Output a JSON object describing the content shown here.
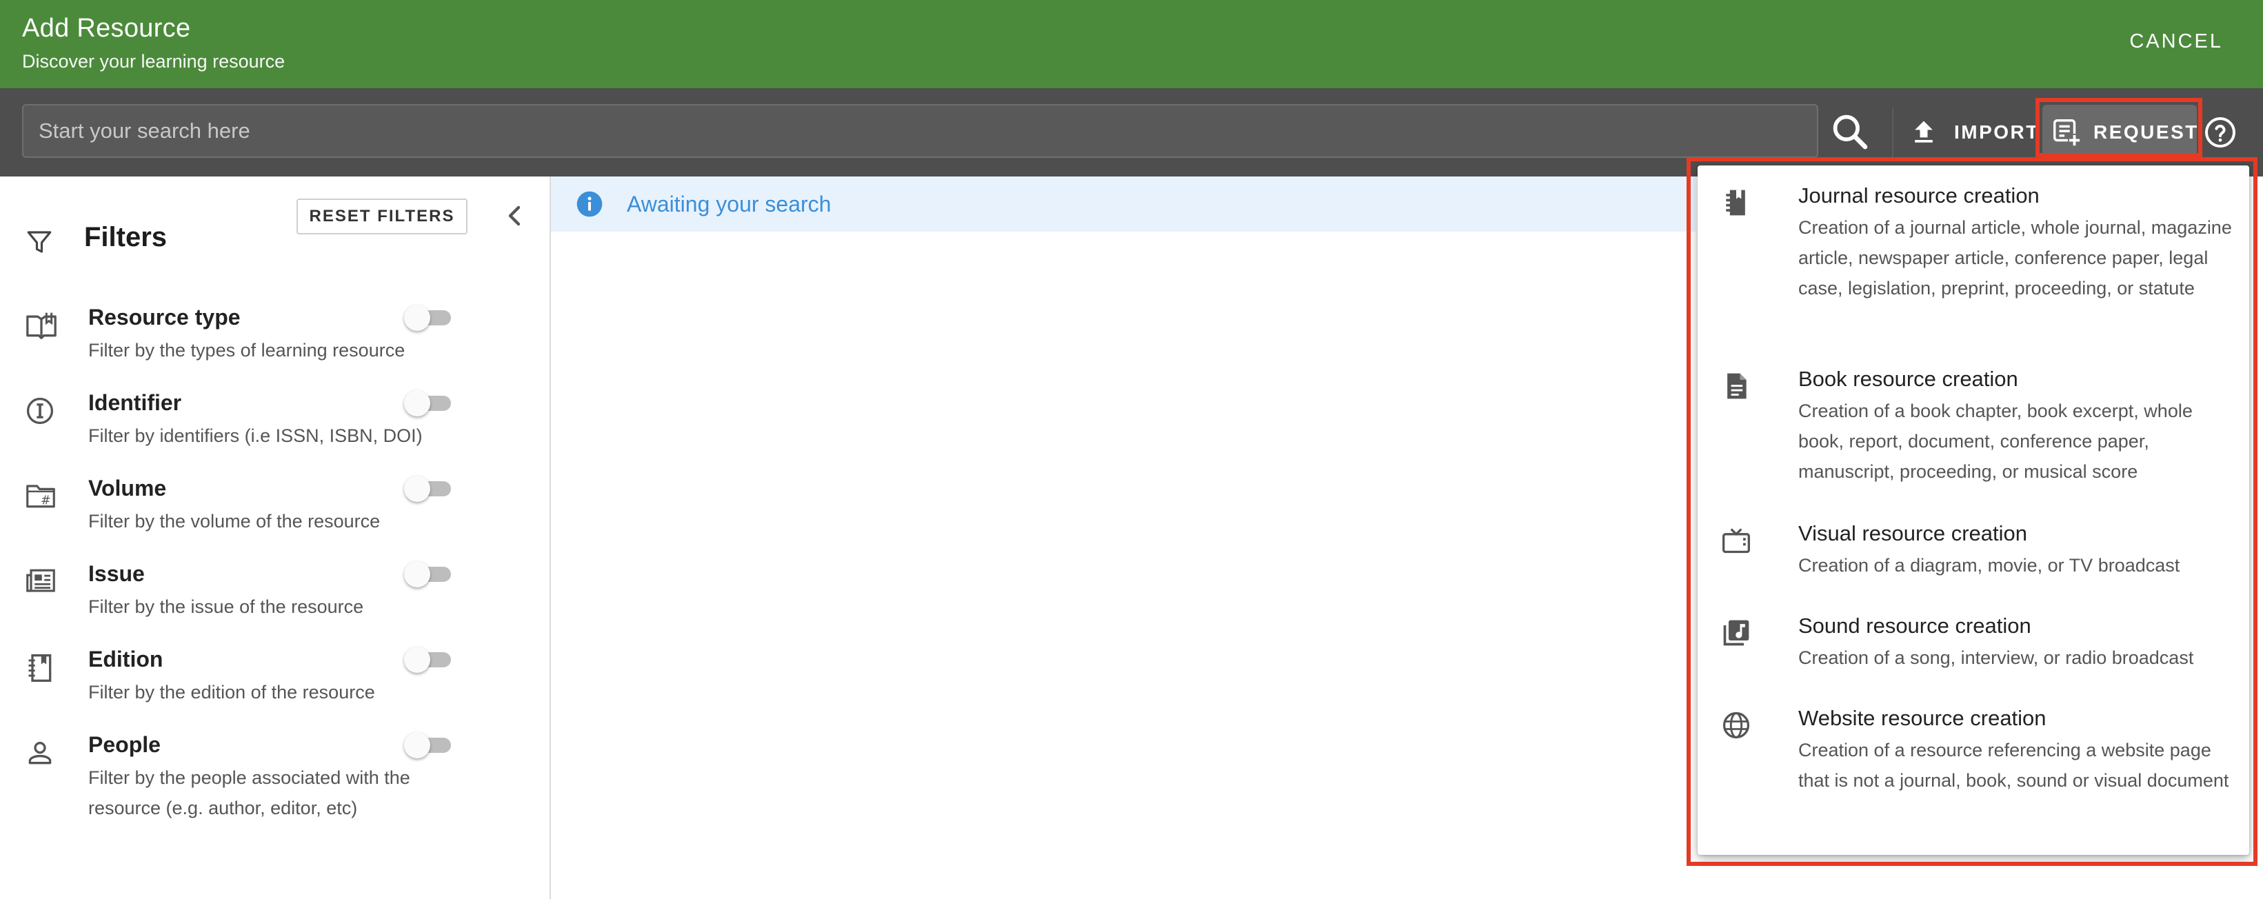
{
  "header": {
    "title": "Add Resource",
    "subtitle": "Discover your learning resource",
    "cancel_label": "CANCEL"
  },
  "toolbar": {
    "search_placeholder": "Start your search here",
    "import_label": "IMPORT",
    "request_label": "REQUEST"
  },
  "sidebar": {
    "reset_label": "RESET FILTERS",
    "title": "Filters",
    "filters": [
      {
        "name": "Resource type",
        "description": "Filter by the types of learning resource",
        "icon": "open-book-icon",
        "enabled": false
      },
      {
        "name": "Identifier",
        "description": "Filter by identifiers (i.e ISSN, ISBN, DOI)",
        "icon": "identifier-info-icon",
        "enabled": false
      },
      {
        "name": "Volume",
        "description": "Filter by the volume of the resource",
        "icon": "folder-hash-icon",
        "enabled": false
      },
      {
        "name": "Issue",
        "description": "Filter by the issue of the resource",
        "icon": "newspaper-icon",
        "enabled": false
      },
      {
        "name": "Edition",
        "description": "Filter by the edition of the resource",
        "icon": "notebook-icon",
        "enabled": false
      },
      {
        "name": "People",
        "description": "Filter by the people associated with the resource (e.g. author, editor, etc)",
        "icon": "person-icon",
        "enabled": false
      }
    ]
  },
  "main": {
    "info_message": "Awaiting your search"
  },
  "request_menu": {
    "items": [
      {
        "title": "Journal resource creation",
        "description": "Creation of a journal article, whole journal, magazine article, newspaper article, conference paper, legal case, legislation, preprint, proceeding, or statute",
        "icon": "journal-icon"
      },
      {
        "title": "Book resource creation",
        "description": "Creation of a book chapter, book excerpt, whole book, report, document, conference paper, manuscript, proceeding, or musical score",
        "icon": "document-icon"
      },
      {
        "title": "Visual resource creation",
        "description": "Creation of a diagram, movie, or TV broadcast",
        "icon": "tv-icon"
      },
      {
        "title": "Sound resource creation",
        "description": "Creation of a song, interview, or radio broadcast",
        "icon": "music-library-icon"
      },
      {
        "title": "Website resource creation",
        "description": "Creation of a resource referencing a website page that is not a journal, book, sound or visual document",
        "icon": "globe-icon"
      }
    ]
  },
  "colors": {
    "header_bg": "#4b8a3b",
    "toolbar_bg": "#4e4e4e",
    "highlight": "#e53a24",
    "info_bg": "#e8f2fd",
    "info_text": "#3b8fd8"
  }
}
